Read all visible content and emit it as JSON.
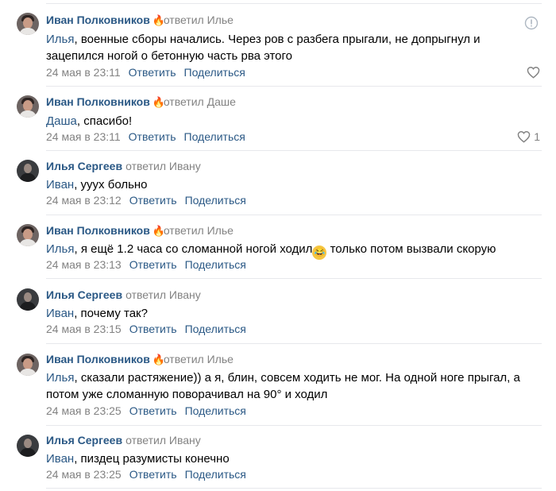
{
  "comments": [
    {
      "author": "Иван Полковников",
      "author_kind": "ivan",
      "reply_to": "ответил Илье",
      "mention": "Илья",
      "body": ", военные сборы начались. Через ров с разбега прыгали, не допрыгнул и зацепился ногой о бетонную часть рва этого",
      "date": "24 мая в 23:11",
      "likes": ""
    },
    {
      "author": "Иван Полковников",
      "author_kind": "ivan",
      "reply_to": "ответил Даше",
      "mention": "Даша",
      "body": ", спасибо!",
      "date": "24 мая в 23:11",
      "likes": "1"
    },
    {
      "author": "Илья Сергеев",
      "author_kind": "ilya",
      "reply_to": "ответил Ивану",
      "mention": "Иван",
      "body": ", ууух больно",
      "date": "24 мая в 23:12",
      "likes": ""
    },
    {
      "author": "Иван Полковников",
      "author_kind": "ivan",
      "reply_to": "ответил Илье",
      "mention": "Илья",
      "body": ", я ещё 1.2 часа со сломанной ногой ходил",
      "body2": " только потом вызвали скорую",
      "date": "24 мая в 23:13",
      "likes": ""
    },
    {
      "author": "Илья Сергеев",
      "author_kind": "ilya",
      "reply_to": "ответил Ивану",
      "mention": "Иван",
      "body": ", почему так?",
      "date": "24 мая в 23:15",
      "likes": ""
    },
    {
      "author": "Иван Полковников",
      "author_kind": "ivan",
      "reply_to": "ответил Илье",
      "mention": "Илья",
      "body": ", сказали растяжение)) а я, блин, совсем ходить не мог. На одной ноге прыгал, а потом уже сломанную поворачивал на 90° и ходил",
      "date": "24 мая в 23:25",
      "likes": ""
    },
    {
      "author": "Илья Сергеев",
      "author_kind": "ilya",
      "reply_to": "ответил Ивану",
      "mention": "Иван",
      "body": ", пиздец разумисты конечно",
      "date": "24 мая в 23:25",
      "likes": ""
    }
  ],
  "actions": {
    "reply": "Ответить",
    "share": "Поделиться"
  },
  "icons": {
    "torch": "torch-icon",
    "like": "heart-icon",
    "report": "report-icon"
  },
  "colors": {
    "link": "#2a5885",
    "muted": "#828282",
    "separator": "#e7e8ec"
  }
}
